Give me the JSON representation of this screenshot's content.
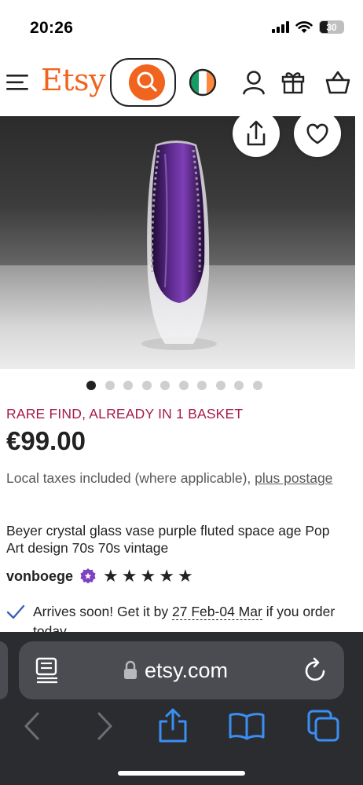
{
  "status_bar": {
    "time": "20:26",
    "battery": "30",
    "icons": [
      "signal-icon",
      "wifi-icon",
      "battery-icon"
    ]
  },
  "header": {
    "logo": "Etsy",
    "icons": [
      "menu-icon",
      "search-icon",
      "ireland-flag-icon",
      "account-icon",
      "gift-icon",
      "basket-icon"
    ],
    "brand_color": "#f1641e"
  },
  "product": {
    "image_buttons": [
      "share-icon",
      "favorite-heart-icon"
    ],
    "image_count": 10,
    "active_image": 1,
    "badge_text": "RARE FIND, ALREADY IN 1 BASKET",
    "badge_color": "#a61a4d",
    "price": "€99.00",
    "tax_note_prefix": "Local taxes included (where applicable),",
    "tax_note_link": "plus postage",
    "title": "Beyer crystal glass vase purple fluted space age Pop Art design 70s 70s vintage",
    "seller": "vonboege",
    "rating_stars": 5,
    "delivery_prefix": "Arrives soon! Get it by",
    "delivery_dates": "27 Feb-04 Mar",
    "delivery_suffix": "if you order today"
  },
  "browser": {
    "url": "etsy.com",
    "toolbar_icons": [
      "back-icon",
      "forward-icon",
      "share-icon",
      "bookmarks-icon",
      "tabs-icon"
    ],
    "accent": "#3a8ff5"
  }
}
